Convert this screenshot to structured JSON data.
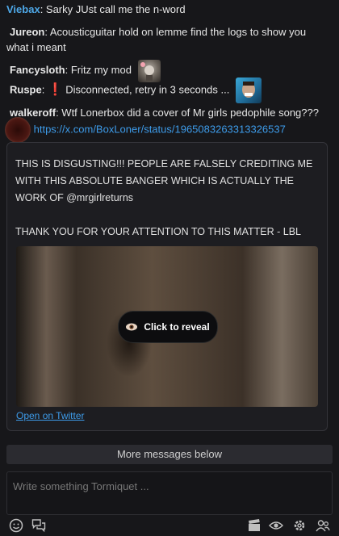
{
  "messages": [
    {
      "user": "Viebax",
      "text": ": Sarky JUst call me the n-word"
    },
    {
      "user": "Jureon",
      "text": ": Acousticguitar hold on lemme find the logs to show you what i meant"
    },
    {
      "user": "Fancysloth",
      "text": ": Fritz my mod"
    },
    {
      "user": "Ruspe",
      "text": ": ",
      "icon": "exclamation-icon",
      "text2": " Disconnected, retry in 3 seconds ..."
    },
    {
      "user": "walkeroff",
      "text": ": Wtf Lonerbox did a cover of Mr girls pedophile song???",
      "link": "https://x.com/BoxLoner/status/1965083263313326537"
    }
  ],
  "embed": {
    "text_line1": "THIS IS DISGUSTING!!! PEOPLE ARE FALSELY CREDITING ME WITH THIS ABSOLUTE BANGER WHICH IS ACTUALLY THE WORK OF @mrgirlreturns",
    "text_line2": "THANK YOU FOR YOUR ATTENTION TO THIS MATTER - LBL",
    "reveal_label": "Click to reveal",
    "twitter_label": "Open on Twitter"
  },
  "more_messages": "More messages below",
  "input": {
    "placeholder": "Write something Tormiquet ..."
  },
  "colors": {
    "background": "#17171a",
    "username_blue": "#4ea8e8",
    "link": "#3d9be9"
  },
  "toolbar_icons": [
    "emoji-icon",
    "chat-bubbles-icon",
    "clapper-icon",
    "eye-icon",
    "gear-icon",
    "users-icon"
  ]
}
